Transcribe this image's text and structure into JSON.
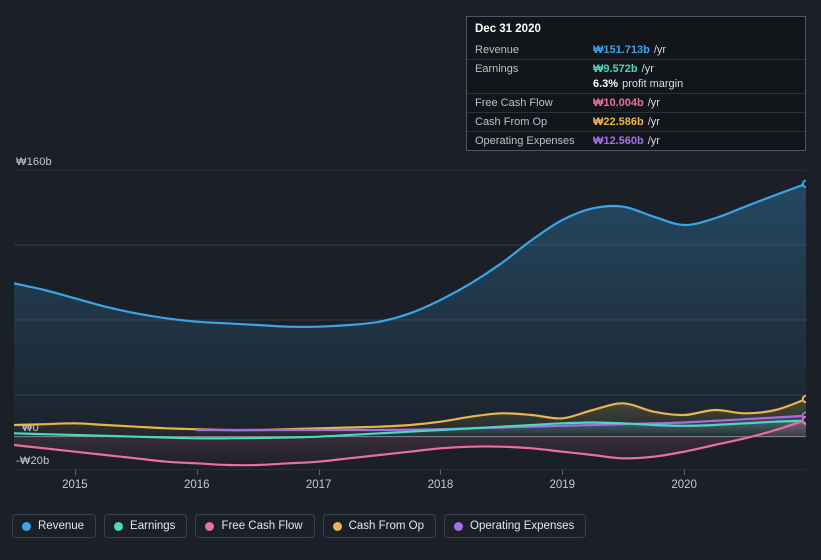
{
  "chart_data": {
    "type": "area",
    "title": "",
    "xlabel": "",
    "ylabel": "",
    "ylim": [
      -20,
      160
    ],
    "yticks": [
      {
        "value": 160,
        "label": "₩160b"
      },
      {
        "value": 0,
        "label": "₩0"
      },
      {
        "value": -20,
        "label": "-₩20b"
      }
    ],
    "xticks": [
      "2015",
      "2016",
      "2017",
      "2018",
      "2019",
      "2020"
    ],
    "grid": true,
    "legend_position": "bottom",
    "x": [
      2014.5,
      2014.75,
      2015.0,
      2015.25,
      2015.5,
      2015.75,
      2016.0,
      2016.25,
      2016.5,
      2016.75,
      2017.0,
      2017.25,
      2017.5,
      2017.75,
      2018.0,
      2018.25,
      2018.5,
      2018.75,
      2019.0,
      2019.25,
      2019.5,
      2019.75,
      2020.0,
      2020.25,
      2020.5,
      2020.75,
      2021.0
    ],
    "series": [
      {
        "name": "Revenue",
        "color": "#39a5e8",
        "values": [
          92,
          88,
          83,
          78,
          74,
          71,
          69,
          68,
          67,
          66,
          66,
          67,
          69,
          74,
          82,
          92,
          104,
          118,
          130,
          137,
          138,
          132,
          127,
          131,
          138,
          145,
          151.7
        ]
      },
      {
        "name": "Earnings",
        "color": "#4bd8c0",
        "values": [
          2,
          1.5,
          1,
          0.5,
          0,
          -0.5,
          -1,
          -1,
          -0.8,
          -0.5,
          0,
          1,
          2,
          3,
          4,
          5,
          6,
          7,
          8,
          8.5,
          8,
          7,
          6.5,
          7,
          8,
          9,
          9.572
        ]
      },
      {
        "name": "Free Cash Flow",
        "color": "#e8709e",
        "values": [
          -5,
          -7,
          -9,
          -11,
          -13,
          -15,
          -16,
          -17,
          -17,
          -16,
          -15,
          -13,
          -11,
          -9,
          -7,
          -6,
          -6,
          -7,
          -9,
          -11,
          -13,
          -12,
          -9,
          -5,
          -1,
          4,
          10.004
        ]
      },
      {
        "name": "Cash From Op",
        "color": "#e8b54a",
        "values": [
          7,
          7.5,
          8,
          7,
          6,
          5,
          4.5,
          4,
          4,
          4.5,
          5,
          5.5,
          6,
          7,
          9,
          12,
          14,
          13,
          11,
          16,
          20,
          15,
          13,
          16,
          14,
          16,
          22.586
        ]
      },
      {
        "name": "Operating Expenses",
        "color": "#a46ee8",
        "values": [
          null,
          null,
          null,
          null,
          null,
          null,
          4,
          4,
          4,
          4,
          4,
          4,
          4,
          4.2,
          4.5,
          5,
          5.5,
          6,
          6.5,
          7,
          7.5,
          8,
          8.5,
          9.5,
          10.5,
          11.5,
          12.56
        ]
      }
    ]
  },
  "tooltip": {
    "title": "Dec 31 2020",
    "rows": [
      {
        "label": "Revenue",
        "value": "₩151.713b",
        "unit": "/yr",
        "color": "#39a5e8"
      },
      {
        "label": "Earnings",
        "value": "₩9.572b",
        "unit": "/yr",
        "color": "#4bd8c0",
        "sub_value": "6.3%",
        "sub_unit": "profit margin"
      },
      {
        "label": "Free Cash Flow",
        "value": "₩10.004b",
        "unit": "/yr",
        "color": "#e8709e"
      },
      {
        "label": "Cash From Op",
        "value": "₩22.586b",
        "unit": "/yr",
        "color": "#e8b54a"
      },
      {
        "label": "Operating Expenses",
        "value": "₩12.560b",
        "unit": "/yr",
        "color": "#a46ee8"
      }
    ]
  },
  "legend": {
    "items": [
      {
        "label": "Revenue",
        "color": "#39a5e8"
      },
      {
        "label": "Earnings",
        "color": "#4bd8c0"
      },
      {
        "label": "Free Cash Flow",
        "color": "#e8709e"
      },
      {
        "label": "Cash From Op",
        "color": "#e8b54a"
      },
      {
        "label": "Operating Expenses",
        "color": "#a46ee8"
      }
    ]
  },
  "axis": {
    "y_top_label": "₩160b",
    "y_zero_label": "₩0",
    "y_bottom_label": "-₩20b"
  }
}
